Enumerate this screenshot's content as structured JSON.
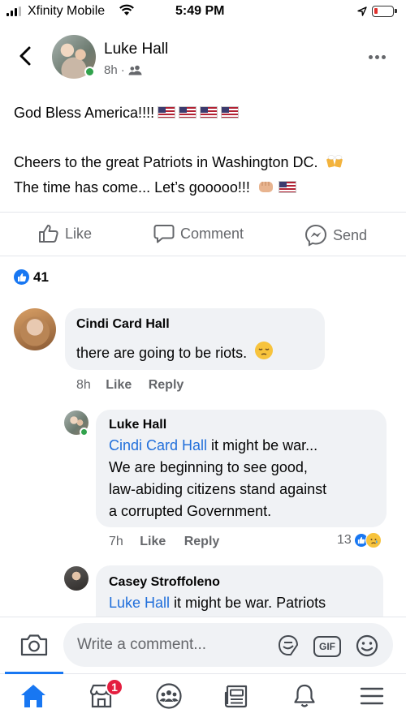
{
  "status_bar": {
    "carrier": "Xfinity Mobile",
    "time": "5:49 PM"
  },
  "post": {
    "author": "Luke Hall",
    "time": "8h",
    "separator": "·",
    "line1": "God Bless America!!!!",
    "line2": "Cheers to the great Patriots in Washington DC.",
    "line3": "The time has come... Let’s gooooo!!!"
  },
  "actions": {
    "like": "Like",
    "comment": "Comment",
    "send": "Send"
  },
  "reactions": {
    "count": "41"
  },
  "comments": [
    {
      "author": "Cindi Card Hall",
      "lines": [
        "there are going to be riots."
      ],
      "time": "8h",
      "like": "Like",
      "reply": "Reply"
    },
    {
      "author": "Luke Hall",
      "mention": "Cindi Card Hall",
      "lines": [
        " it might be war...",
        "We are beginning to see good,",
        "law-abiding citizens stand against",
        "a corrupted Government."
      ],
      "time": "7h",
      "like": "Like",
      "reply": "Reply",
      "reaction_count": "13"
    },
    {
      "author": "Casey Stroffoleno",
      "mention": "Luke Hall",
      "lines": [
        " it might be war. Patriots"
      ]
    }
  ],
  "composer": {
    "placeholder": "Write a comment...",
    "gif_label": "GIF"
  },
  "tabbar": {
    "marketplace_badge": "1",
    "active_tab": "home"
  },
  "colors": {
    "accent": "#1877f2",
    "link": "#216fdb",
    "online": "#31a24c",
    "badge": "#e41e3f"
  },
  "icons": [
    "back-icon",
    "friends-audience-icon",
    "more-icon",
    "like-icon",
    "comment-icon",
    "messenger-send-icon",
    "camera-icon",
    "sticker-icon",
    "gif-icon",
    "emoji-icon",
    "home-icon",
    "marketplace-icon",
    "groups-icon",
    "news-icon",
    "bell-icon",
    "menu-icon"
  ]
}
